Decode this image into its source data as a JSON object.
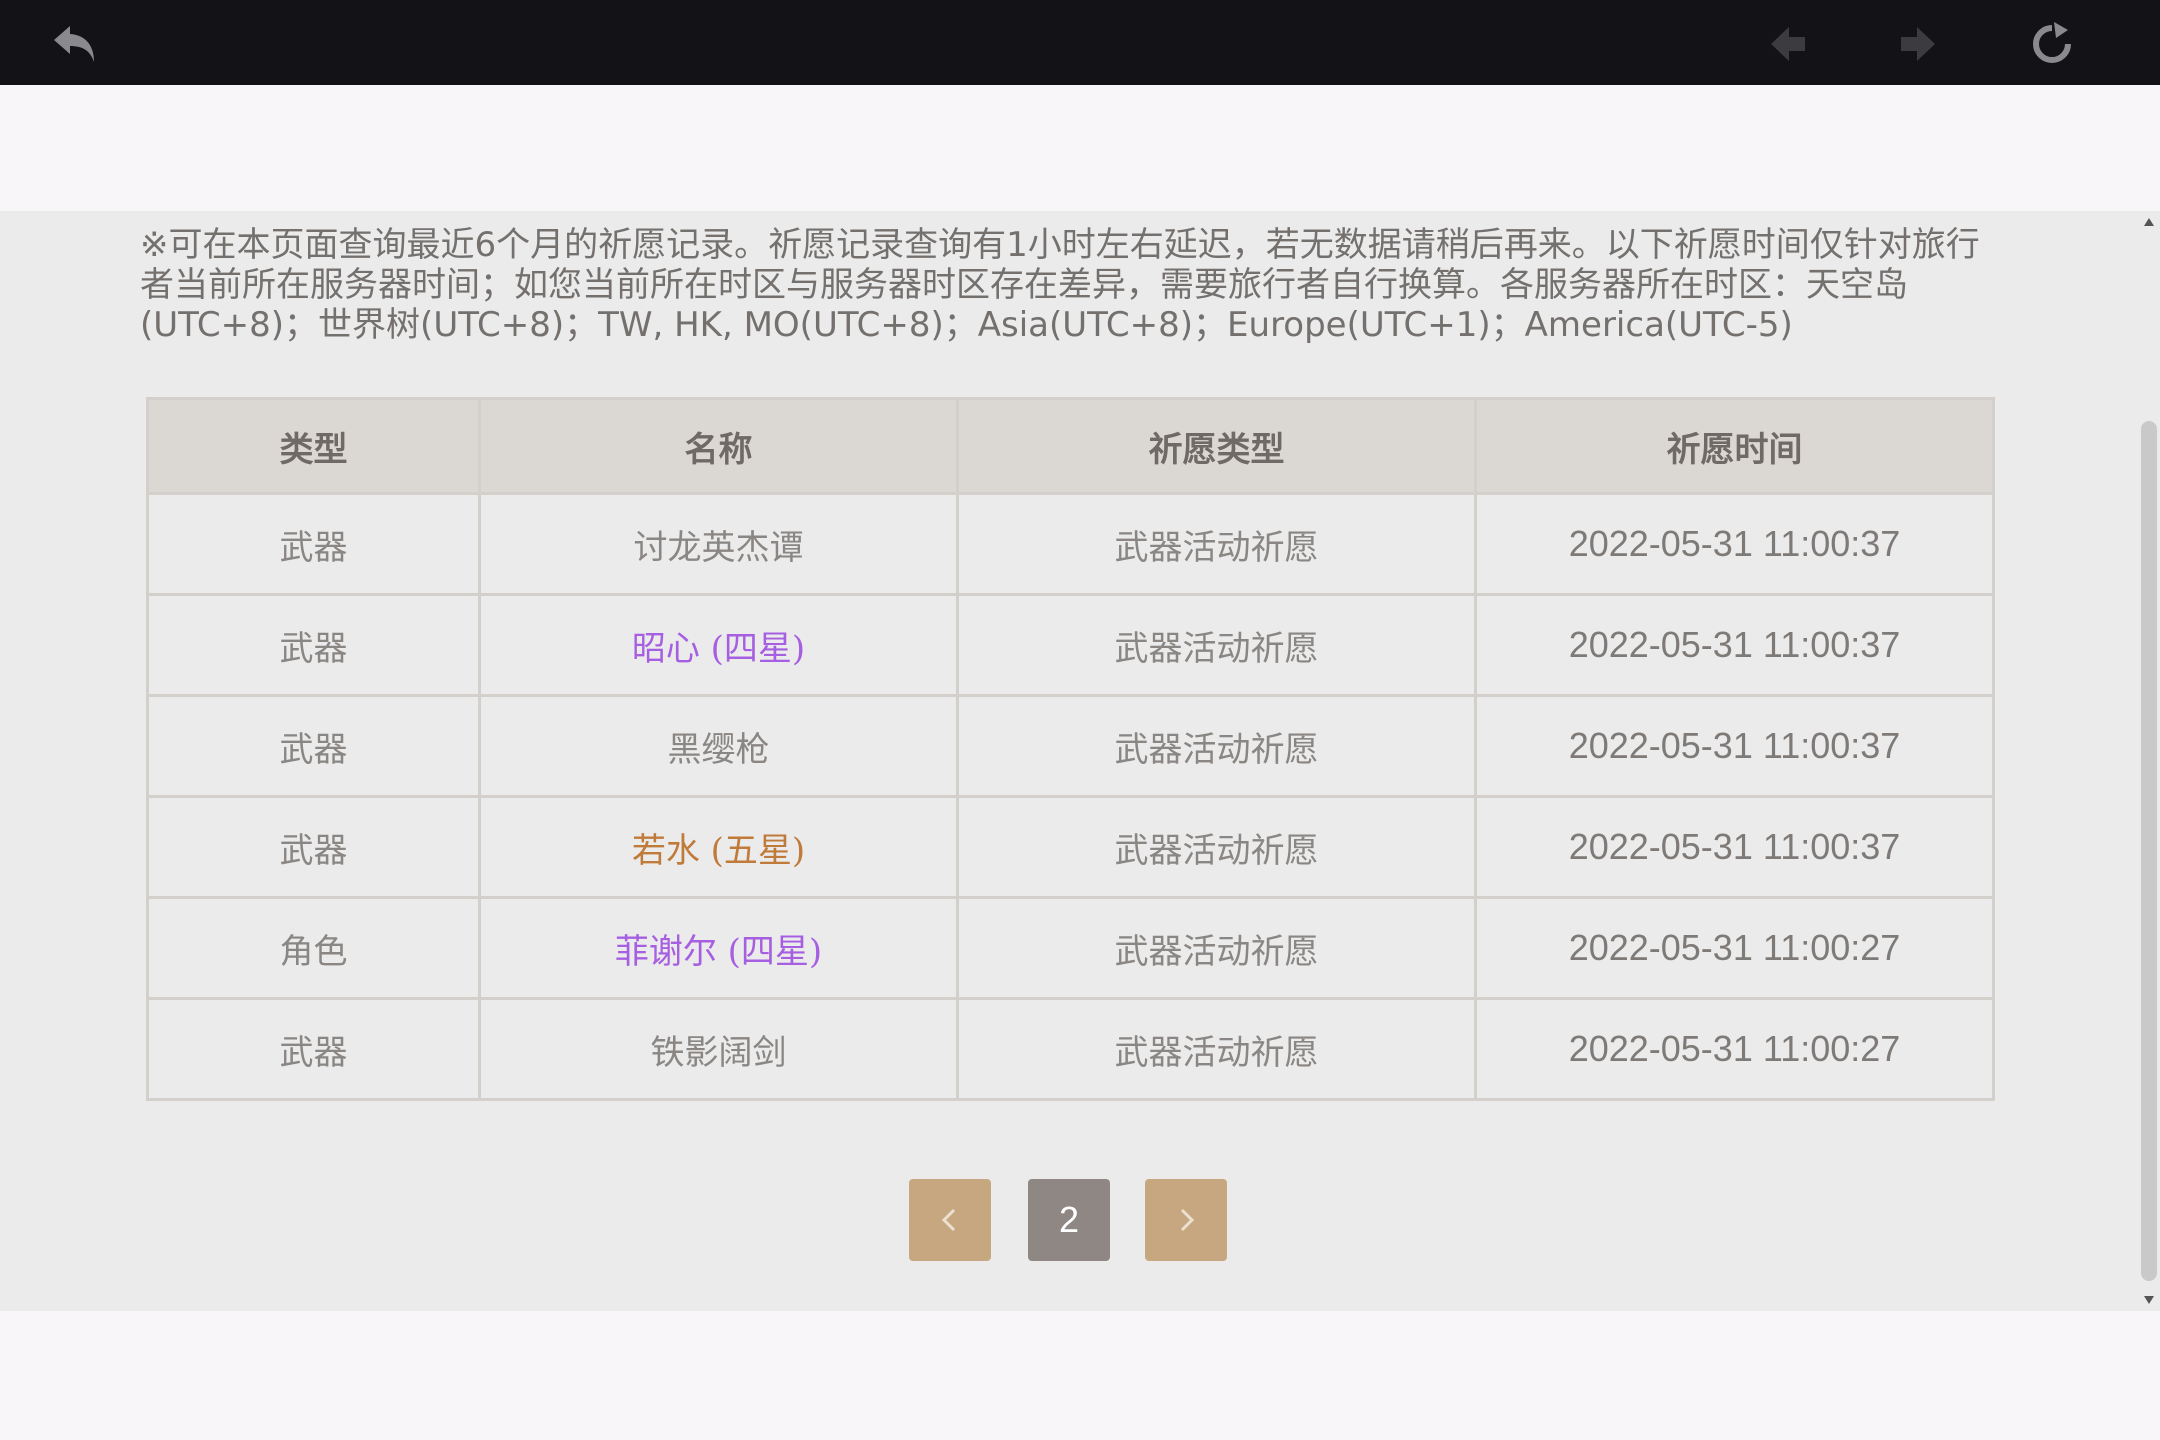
{
  "colors": {
    "topbar_bg": "#131317",
    "content_bg": "#ebebeb",
    "header_bg": "#dbd7d2",
    "four_star": "#a65fe0",
    "five_star": "#c07a3a",
    "pager_nav": "#c7a77f",
    "pager_current": "#8f8783"
  },
  "topbar": {
    "icons": [
      "back-arrow-icon",
      "prev-arrow-icon",
      "next-arrow-icon",
      "reload-icon"
    ]
  },
  "notice": {
    "text": "※可在本页面查询最近6个月的祈愿记录。祈愿记录查询有1小时左右延迟，若无数据请稍后再来。以下祈愿时间仅针对旅行者当前所在服务器时间；如您当前所在时区与服务器时区存在差异，需要旅行者自行换算。各服务器所在时区：天空岛(UTC+8)；世界树(UTC+8)；TW, HK, MO(UTC+8)；Asia(UTC+8)；Europe(UTC+1)；America(UTC-5)"
  },
  "table": {
    "headers": [
      "类型",
      "名称",
      "祈愿类型",
      "祈愿时间"
    ],
    "rows": [
      {
        "type": "武器",
        "name": "讨龙英杰谭",
        "rarity": "three",
        "wish_type": "武器活动祈愿",
        "time": "2022-05-31 11:00:37"
      },
      {
        "type": "武器",
        "name": "昭心 (四星)",
        "rarity": "four",
        "wish_type": "武器活动祈愿",
        "time": "2022-05-31 11:00:37"
      },
      {
        "type": "武器",
        "name": "黑缨枪",
        "rarity": "three",
        "wish_type": "武器活动祈愿",
        "time": "2022-05-31 11:00:37"
      },
      {
        "type": "武器",
        "name": "若水 (五星)",
        "rarity": "five",
        "wish_type": "武器活动祈愿",
        "time": "2022-05-31 11:00:37"
      },
      {
        "type": "角色",
        "name": "菲谢尔 (四星)",
        "rarity": "four",
        "wish_type": "武器活动祈愿",
        "time": "2022-05-31 11:00:27"
      },
      {
        "type": "武器",
        "name": "铁影阔剑",
        "rarity": "three",
        "wish_type": "武器活动祈愿",
        "time": "2022-05-31 11:00:27"
      }
    ]
  },
  "pagination": {
    "prev_icon": "chevron-left-icon",
    "current_page": "2",
    "next_icon": "chevron-right-icon"
  }
}
